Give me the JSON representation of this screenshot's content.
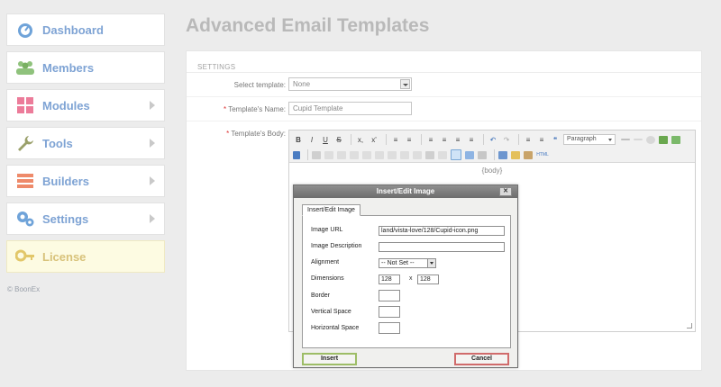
{
  "sidebar": {
    "items": [
      {
        "label": "Dashboard",
        "icon": "dashboard-gauge-icon",
        "arrow": false
      },
      {
        "label": "Members",
        "icon": "members-icon",
        "arrow": false
      },
      {
        "label": "Modules",
        "icon": "modules-grid-icon",
        "arrow": true
      },
      {
        "label": "Tools",
        "icon": "wrench-icon",
        "arrow": true
      },
      {
        "label": "Builders",
        "icon": "builders-icon",
        "arrow": true
      },
      {
        "label": "Settings",
        "icon": "gears-icon",
        "arrow": true
      },
      {
        "label": "License",
        "icon": "key-icon",
        "arrow": false
      }
    ],
    "copyright": "© BoonEx"
  },
  "page": {
    "title": "Advanced Email Templates"
  },
  "settings": {
    "heading": "SETTINGS",
    "select_label": "Select template:",
    "select_value": "None",
    "name_label": "Template's Name:",
    "name_value": "Cupid Template",
    "body_label": "Template's Body:",
    "required_mark": "*"
  },
  "editor": {
    "format_value": "Paragraph",
    "body_text": "{body}",
    "toolbar_row1": [
      "B",
      "I",
      "U",
      "S",
      "x,",
      "x'",
      "≡",
      "≡",
      "≡",
      "≡",
      "≡",
      "≡",
      "↶",
      "↷",
      "≡",
      "≡",
      "❝"
    ],
    "html_label": "HTML"
  },
  "dialog": {
    "title": "Insert/Edit Image",
    "close": "✕",
    "tab": "Insert/Edit Image",
    "fields": {
      "image_url_label": "Image URL",
      "image_url_value": "land/vista-love/128/Cupid-icon.png",
      "description_label": "Image Description",
      "description_value": "",
      "alignment_label": "Alignment",
      "alignment_value": "-- Not Set --",
      "dimensions_label": "Dimensions",
      "width_value": "128",
      "dim_separator": "x",
      "height_value": "128",
      "border_label": "Border",
      "vspace_label": "Vertical Space",
      "hspace_label": "Horizontal Space"
    },
    "insert_label": "Insert",
    "cancel_label": "Cancel"
  },
  "colors": {
    "sidebar_text": "#7ea3d4",
    "license_text": "#d8c27a",
    "insert_border": "#9dbd66",
    "cancel_border": "#d06b6b"
  }
}
